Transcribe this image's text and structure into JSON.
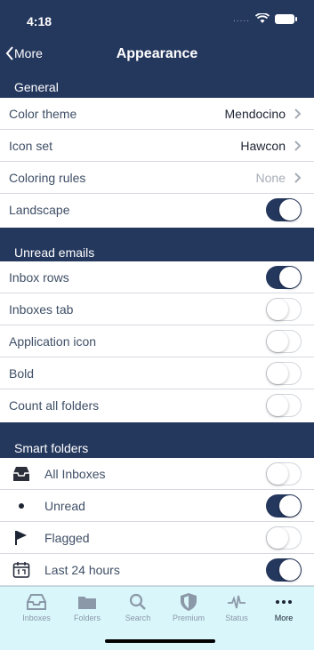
{
  "status_bar": {
    "time": "4:18",
    "signal_dots": "....."
  },
  "nav": {
    "back_label": "More",
    "title": "Appearance"
  },
  "general": {
    "header": "General",
    "color_theme": {
      "label": "Color theme",
      "value": "Mendocino"
    },
    "icon_set": {
      "label": "Icon set",
      "value": "Hawcon"
    },
    "coloring_rules": {
      "label": "Coloring rules",
      "value": "None"
    },
    "landscape": {
      "label": "Landscape",
      "enabled": true
    }
  },
  "unread_emails": {
    "header": "Unread emails",
    "items": [
      {
        "label": "Inbox rows",
        "enabled": true
      },
      {
        "label": "Inboxes tab",
        "enabled": false
      },
      {
        "label": "Application icon",
        "enabled": false
      },
      {
        "label": "Bold",
        "enabled": false
      },
      {
        "label": "Count all folders",
        "enabled": false
      }
    ]
  },
  "smart_folders": {
    "header": "Smart folders",
    "items": [
      {
        "label": "All Inboxes",
        "icon": "inbox-tray-icon",
        "enabled": false
      },
      {
        "label": "Unread",
        "icon": "dot-icon",
        "enabled": true
      },
      {
        "label": "Flagged",
        "icon": "flag-icon",
        "enabled": false
      },
      {
        "label": "Last 24 hours",
        "icon": "calendar-icon",
        "enabled": true
      }
    ]
  },
  "tab_bar": {
    "tabs": [
      {
        "label": "Inboxes",
        "icon": "inbox-icon"
      },
      {
        "label": "Folders",
        "icon": "folder-icon"
      },
      {
        "label": "Search",
        "icon": "search-icon"
      },
      {
        "label": "Premium",
        "icon": "shield-icon"
      },
      {
        "label": "Status",
        "icon": "pulse-icon"
      },
      {
        "label": "More",
        "icon": "more-dots-icon"
      }
    ],
    "active": "More"
  },
  "colors": {
    "header_bg": "#24375d",
    "toggle_on": "#24375d",
    "tab_bar_bg": "#d9f6fb"
  }
}
